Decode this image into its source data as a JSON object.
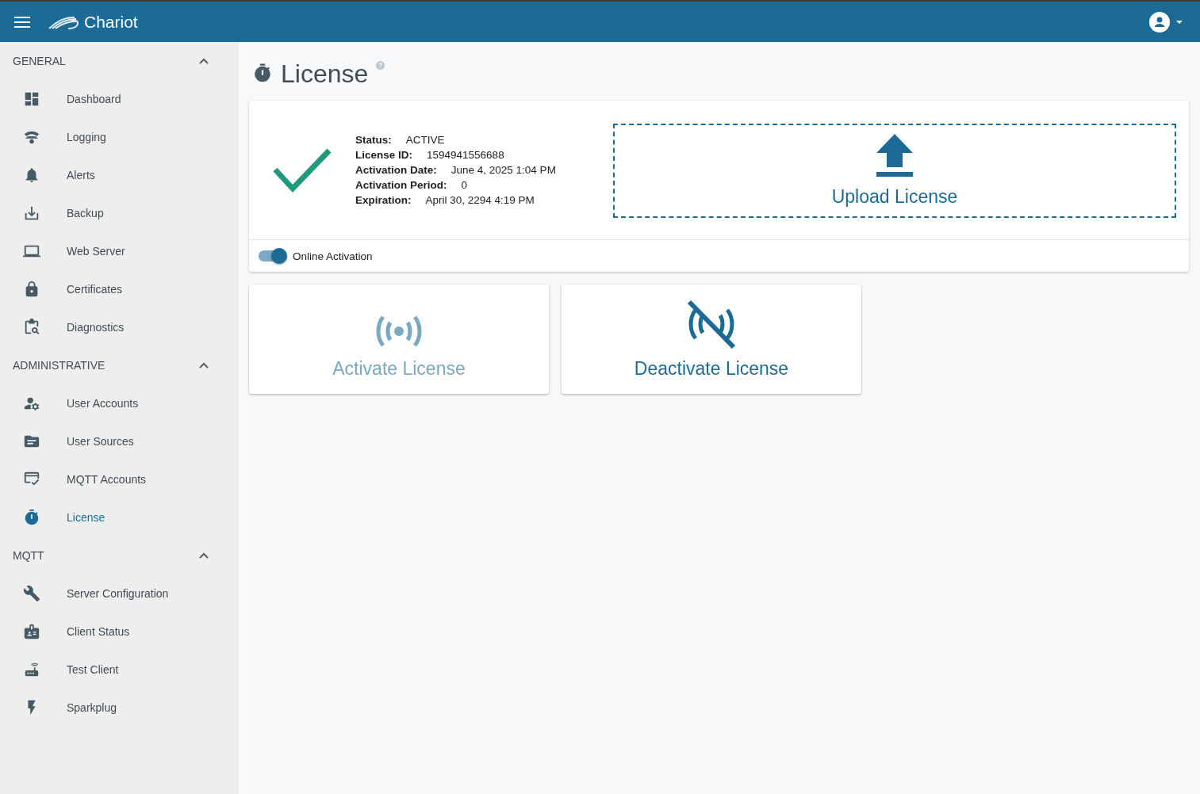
{
  "header": {
    "brand": "Chariot"
  },
  "sidebar": {
    "sections": [
      {
        "title": "GENERAL",
        "expanded": true,
        "items": [
          {
            "label": "Dashboard",
            "selected": false
          },
          {
            "label": "Logging",
            "selected": false
          },
          {
            "label": "Alerts",
            "selected": false
          },
          {
            "label": "Backup",
            "selected": false
          },
          {
            "label": "Web Server",
            "selected": false
          },
          {
            "label": "Certificates",
            "selected": false
          },
          {
            "label": "Diagnostics",
            "selected": false
          }
        ]
      },
      {
        "title": "ADMINISTRATIVE",
        "expanded": true,
        "items": [
          {
            "label": "User Accounts",
            "selected": false
          },
          {
            "label": "User Sources",
            "selected": false
          },
          {
            "label": "MQTT Accounts",
            "selected": false
          },
          {
            "label": "License",
            "selected": true
          }
        ]
      },
      {
        "title": "MQTT",
        "expanded": true,
        "items": [
          {
            "label": "Server Configuration",
            "selected": false
          },
          {
            "label": "Client Status",
            "selected": false
          },
          {
            "label": "Test Client",
            "selected": false
          },
          {
            "label": "Sparkplug",
            "selected": false
          }
        ]
      }
    ]
  },
  "page": {
    "title": "License"
  },
  "license": {
    "details": [
      {
        "label": "Status:",
        "value": "ACTIVE"
      },
      {
        "label": "License ID:",
        "value": "1594941556688"
      },
      {
        "label": "Activation Date:",
        "value": "June 4, 2025 1:04 PM"
      },
      {
        "label": "Activation Period:",
        "value": "0"
      },
      {
        "label": "Expiration:",
        "value": "April 30, 2294 4:19 PM"
      }
    ],
    "upload_label": "Upload License",
    "online_activation": {
      "label": "Online Activation",
      "on": true
    }
  },
  "actions": [
    {
      "label": "Activate License",
      "disabled": true
    },
    {
      "label": "Deactivate License",
      "disabled": false
    }
  ]
}
